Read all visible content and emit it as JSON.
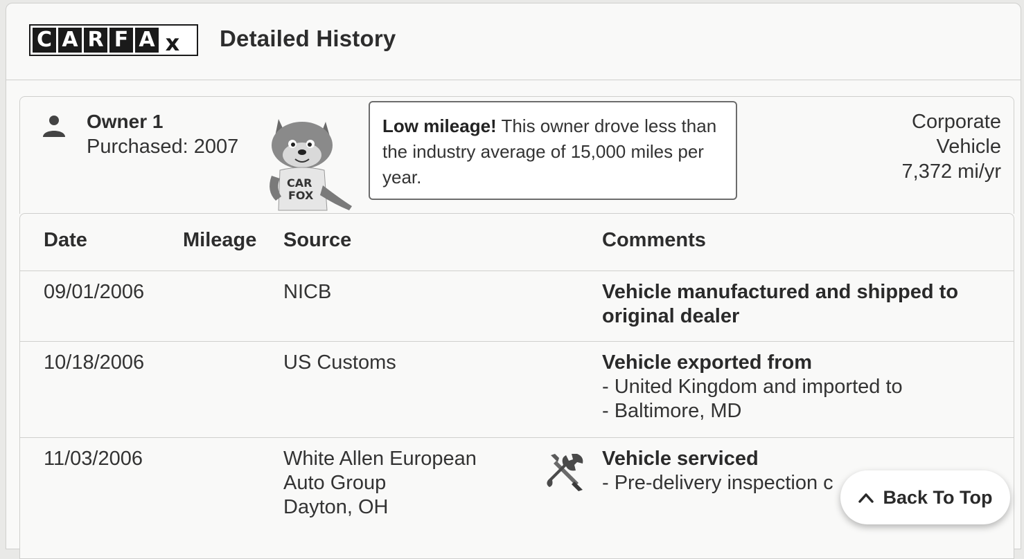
{
  "header": {
    "logo_letters": [
      "C",
      "A",
      "R",
      "F",
      "A",
      "x"
    ],
    "title": "Detailed History"
  },
  "owner": {
    "name": "Owner 1",
    "purchased": "Purchased: 2007",
    "mascot_shirt": "CAR FOX",
    "tip_bold": "Low mileage!",
    "tip_text": " This owner drove less than the industry average of 15,000 miles per year.",
    "type_line1": "Corporate",
    "type_line2": "Vehicle",
    "mileage_rate": "7,372 mi/yr"
  },
  "table": {
    "columns": [
      "Date",
      "Mileage",
      "Source",
      "Comments"
    ],
    "rows": [
      {
        "date": "09/01/2006",
        "mileage": "",
        "source": [
          "NICB"
        ],
        "comment_title": "Vehicle manufactured and shipped to original dealer",
        "comment_lines": []
      },
      {
        "date": "10/18/2006",
        "mileage": "",
        "source": [
          "US Customs"
        ],
        "comment_title": "Vehicle exported from",
        "comment_lines": [
          "- United Kingdom and imported to",
          "- Baltimore, MD"
        ]
      },
      {
        "date": "11/03/2006",
        "mileage": "",
        "source": [
          "White Allen European",
          "Auto Group",
          "Dayton, OH"
        ],
        "icon": "wrench-screwdriver-icon",
        "comment_title": "Vehicle serviced",
        "comment_lines": [
          "- Pre-delivery inspection c"
        ]
      }
    ]
  },
  "back_to_top": {
    "label": "Back To Top",
    "icon": "chevron-up-icon"
  }
}
